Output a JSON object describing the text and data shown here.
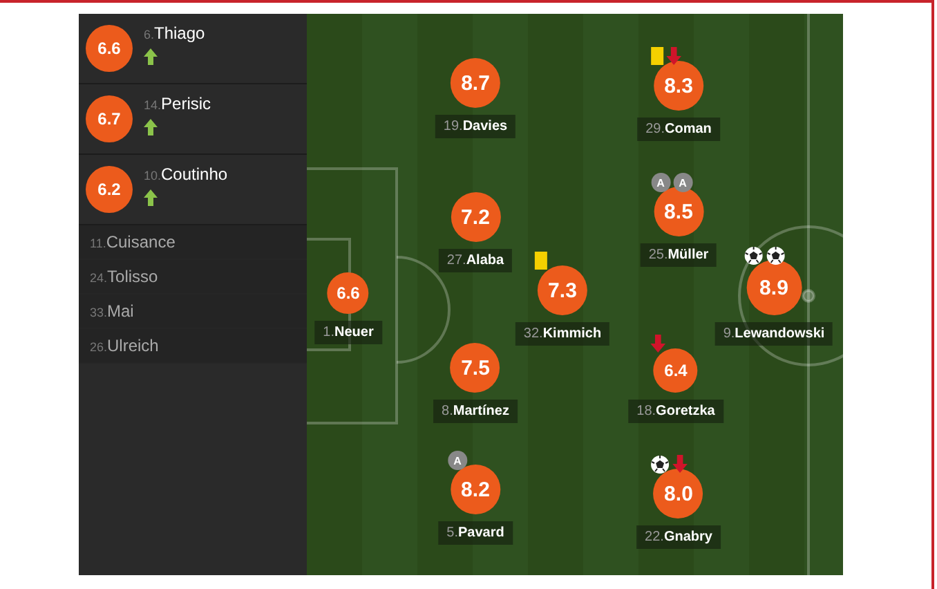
{
  "bench": [
    {
      "number": "6.",
      "name": "Thiago",
      "rating": "6.6",
      "subbed_on": true
    },
    {
      "number": "14.",
      "name": "Perisic",
      "rating": "6.7",
      "subbed_on": true
    },
    {
      "number": "10.",
      "name": "Coutinho",
      "rating": "6.2",
      "subbed_on": true
    },
    {
      "number": "11.",
      "name": "Cuisance"
    },
    {
      "number": "24.",
      "name": "Tolisso"
    },
    {
      "number": "33.",
      "name": "Mai"
    },
    {
      "number": "26.",
      "name": "Ulreich"
    }
  ],
  "players": [
    {
      "number": "1.",
      "name": "Neuer",
      "rating": "6.6"
    },
    {
      "number": "19.",
      "name": "Davies",
      "rating": "8.7"
    },
    {
      "number": "27.",
      "name": "Alaba",
      "rating": "7.2"
    },
    {
      "number": "8.",
      "name": "Martínez",
      "rating": "7.5"
    },
    {
      "number": "5.",
      "name": "Pavard",
      "rating": "8.2",
      "events": [
        {
          "kind": "assist",
          "label": "A"
        }
      ]
    },
    {
      "number": "32.",
      "name": "Kimmich",
      "rating": "7.3",
      "events": [
        {
          "kind": "yellow"
        }
      ]
    },
    {
      "number": "29.",
      "name": "Coman",
      "rating": "8.3",
      "events": [
        {
          "kind": "yellow"
        },
        {
          "kind": "subbed_off"
        }
      ]
    },
    {
      "number": "25.",
      "name": "Müller",
      "rating": "8.5",
      "events": [
        {
          "kind": "assist",
          "label": "A"
        },
        {
          "kind": "assist",
          "label": "A"
        }
      ]
    },
    {
      "number": "18.",
      "name": "Goretzka",
      "rating": "6.4",
      "events": [
        {
          "kind": "subbed_off"
        }
      ]
    },
    {
      "number": "22.",
      "name": "Gnabry",
      "rating": "8.0",
      "events": [
        {
          "kind": "goal"
        },
        {
          "kind": "subbed_off"
        }
      ]
    },
    {
      "number": "9.",
      "name": "Lewandowski",
      "rating": "8.9",
      "events": [
        {
          "kind": "goal"
        },
        {
          "kind": "goal"
        }
      ]
    }
  ]
}
